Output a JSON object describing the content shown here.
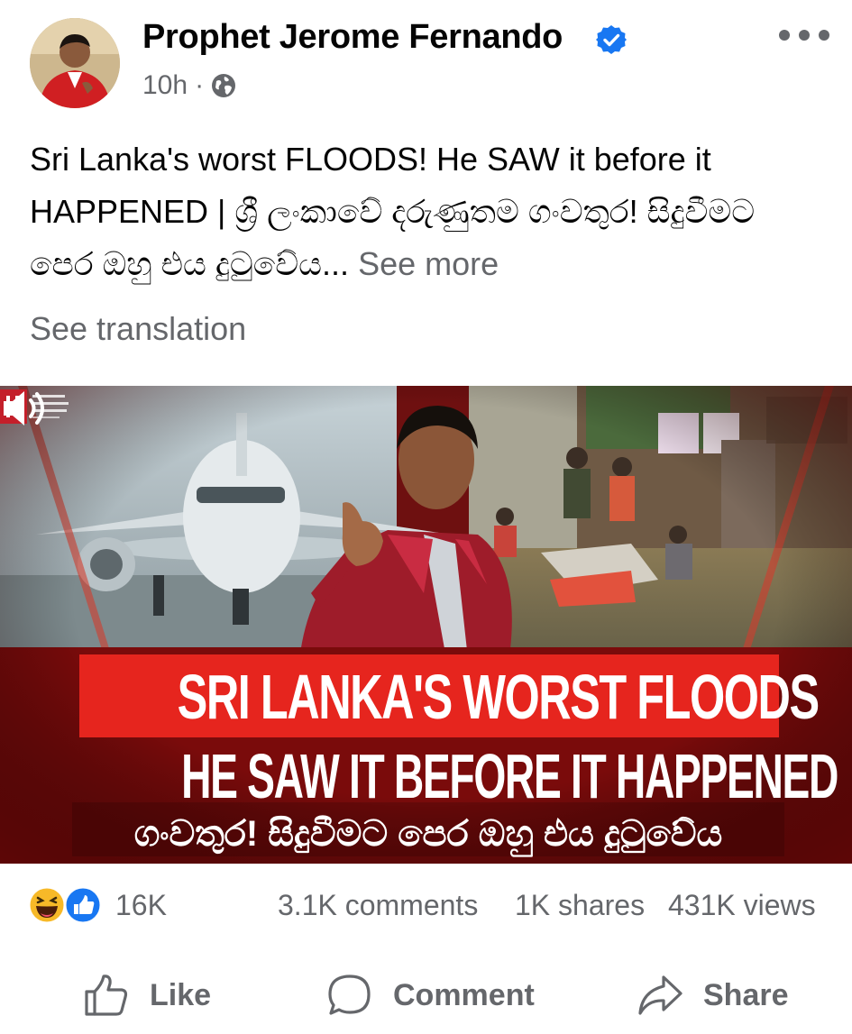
{
  "post": {
    "author": "Prophet Jerome Fernando",
    "time": "10h",
    "separator": "·",
    "text": "Sri Lanka's worst FLOODS! He SAW it before it HAPPENED | ශ්‍රී ලංකාවේ දරුණුතම ගංවතුර! සිදුවීමට පෙර ඔහු එය දුටුවේය...",
    "see_more": "See more",
    "see_translation": "See translation"
  },
  "media": {
    "headline_line1": "SRI LANKA'S WORST FLOODS",
    "headline_line2": "HE SAW IT BEFORE IT HAPPENED",
    "headline_line3": "ගංවතුර! සිදුවීමට පෙර ඔහු එය දුටුවේය"
  },
  "stats": {
    "reactions": "16K",
    "comments": "3.1K comments",
    "shares": "1K shares",
    "views": "431K views"
  },
  "actions": {
    "like": "Like",
    "comment": "Comment",
    "share": "Share"
  },
  "icons": {
    "more": "more-options-icon",
    "verified": "verified-badge-icon",
    "privacy": "globe-icon",
    "volume": "volume-icon",
    "reaction1": "haha-reaction-icon",
    "reaction2": "like-reaction-icon"
  },
  "colors": {
    "verified_blue": "#1877f2",
    "muted_text": "#65676b",
    "banner_red": "#e6251e"
  }
}
